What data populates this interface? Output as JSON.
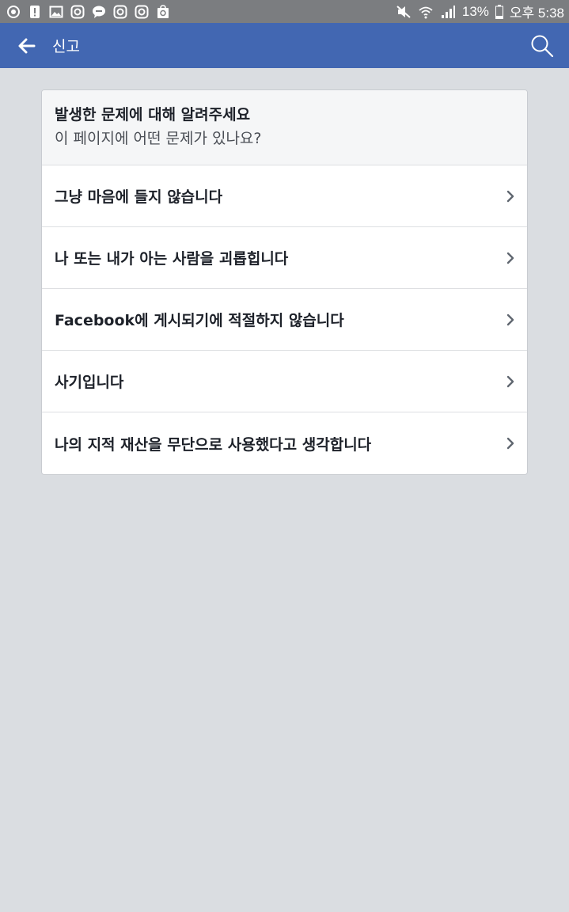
{
  "status_bar": {
    "battery": "13%",
    "time": "오후 5:38",
    "left_icons": [
      "app-icon",
      "alert-icon",
      "gallery-icon",
      "instagram-icon",
      "talk-icon",
      "instagram-icon",
      "instagram-icon",
      "store-icon"
    ],
    "right_icons": [
      "mute-icon",
      "wifi-icon",
      "signal-icon",
      "battery-icon"
    ]
  },
  "app_bar": {
    "title": "신고",
    "color": "#4267b2"
  },
  "report_card": {
    "title": "발생한 문제에 대해 알려주세요",
    "subtitle": "이 페이지에 어떤 문제가 있나요?",
    "options": [
      {
        "label": "그냥 마음에 들지 않습니다"
      },
      {
        "label": "나 또는 내가 아는 사람을 괴롭힙니다"
      },
      {
        "label": "Facebook에 게시되기에 적절하지 않습니다"
      },
      {
        "label": "사기입니다"
      },
      {
        "label": "나의 지적 재산을 무단으로 사용했다고 생각합니다"
      }
    ]
  }
}
